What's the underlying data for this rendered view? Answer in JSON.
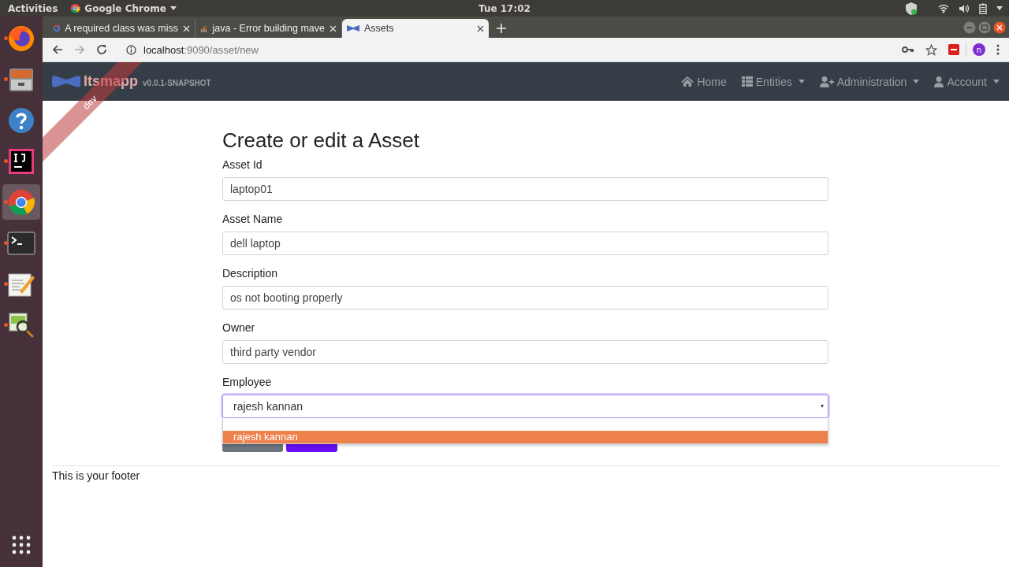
{
  "top_bar": {
    "activities": "Activities",
    "app_menu": "Google Chrome",
    "clock": "Tue 17:02"
  },
  "dock": [
    {
      "kind": "firefox",
      "running": true,
      "selected": false
    },
    {
      "kind": "files",
      "running": true,
      "selected": false
    },
    {
      "kind": "help",
      "running": false,
      "selected": false
    },
    {
      "kind": "ide",
      "running": true,
      "selected": false
    },
    {
      "kind": "chrome",
      "running": true,
      "selected": true
    },
    {
      "kind": "terminal",
      "running": true,
      "selected": false
    },
    {
      "kind": "editor",
      "running": true,
      "selected": false
    },
    {
      "kind": "viewer",
      "running": true,
      "selected": false
    }
  ],
  "tabs": [
    {
      "title": "A required class was miss",
      "kind": "google",
      "selected": false
    },
    {
      "title": "java - Error building mave",
      "kind": "stack",
      "selected": false
    },
    {
      "title": "Assets",
      "kind": "bowtie",
      "selected": true
    }
  ],
  "address_bar": {
    "host": "localhost",
    "rest": ":9090/asset/new"
  },
  "profile_initial": "n",
  "app": {
    "brand": "Itsmapp",
    "version": "v0.0.1-SNAPSHOT",
    "ribbon": "dev",
    "nav": [
      {
        "label": "Home",
        "kind": "home",
        "caret": false
      },
      {
        "label": "Entities",
        "kind": "list",
        "caret": true
      },
      {
        "label": "Administration",
        "kind": "user-plus",
        "caret": true
      },
      {
        "label": "Account",
        "kind": "user",
        "caret": true
      }
    ]
  },
  "form": {
    "title": "Create or edit a Asset",
    "fields": [
      {
        "label": "Asset Id",
        "value": "laptop01"
      },
      {
        "label": "Asset Name",
        "value": "dell laptop"
      },
      {
        "label": "Description",
        "value": "os not booting properly"
      },
      {
        "label": "Owner",
        "value": "third party vendor"
      }
    ],
    "select": {
      "label": "Employee",
      "value": "rajesh kannan",
      "expanded": true,
      "options": [
        {
          "label": "rajesh kannan",
          "selected": true
        }
      ]
    }
  },
  "footer": "This is your footer"
}
